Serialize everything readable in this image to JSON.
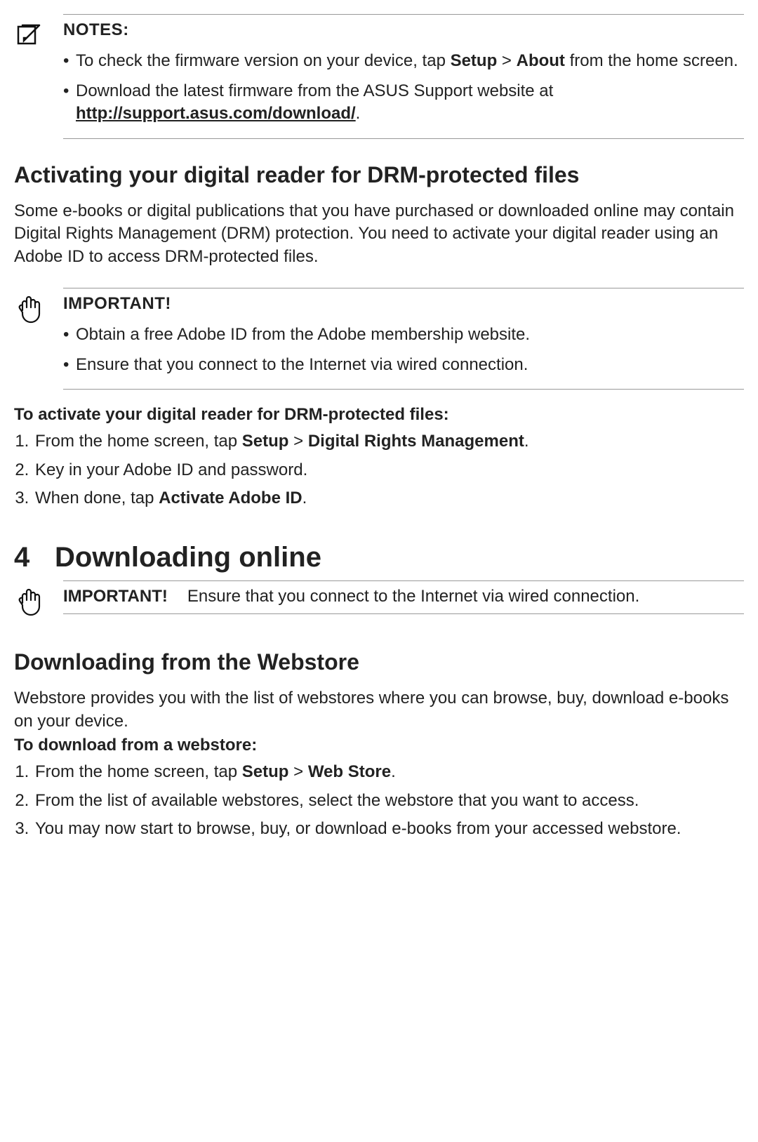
{
  "notes": {
    "title": "NOTES",
    "b1_pre": "To check the firmware version on your device, tap ",
    "b1_setup": "Setup",
    "b1_gt": " > ",
    "b1_about": "About",
    "b1_post": " from the home screen.",
    "b2_pre": "Download the latest firmware from the ASUS Support website at ",
    "b2_link": "http://support.asus.com/download/",
    "b2_post": "."
  },
  "drm": {
    "heading": "Activating your digital reader for DRM-protected files",
    "para": "Some e-books or digital publications that you have purchased or downloaded online may contain Digital Rights Management (DRM) protection. You need to activate your digital reader using an Adobe ID to access DRM-protected files.",
    "important_title": "IMPORTANT",
    "imp1": "Obtain a free Adobe ID from the Adobe membership website.",
    "imp2": "Ensure that you connect to the Internet via wired connection.",
    "steps_title": "To activate your digital reader for DRM-protected files:",
    "s1_pre": "From the home screen, tap ",
    "s1_setup": "Setup",
    "s1_gt": " > ",
    "s1_drm": "Digital Rights Management",
    "s1_post": ".",
    "s2": "Key in your Adobe ID and password.",
    "s3_pre": "When done, tap ",
    "s3_act": "Activate Adobe ID",
    "s3_post": "."
  },
  "chapter": {
    "num": "4",
    "title": "Downloading online",
    "important_title": "IMPORTANT",
    "important_text": "Ensure that you connect to the Internet via wired connection."
  },
  "webstore": {
    "heading": "Downloading from the Webstore",
    "para": "Webstore provides you with the list of webstores where you can browse, buy, download e-books on your device.",
    "steps_title": "To download from a webstore:",
    "s1_pre": "From the home screen, tap ",
    "s1_setup": "Setup",
    "s1_gt": " > ",
    "s1_ws": "Web Store",
    "s1_post": ".",
    "s2": "From the list of available webstores, select the webstore that you want to access.",
    "s3": "You may now start to browse, buy, or download e-books from your accessed webstore."
  }
}
